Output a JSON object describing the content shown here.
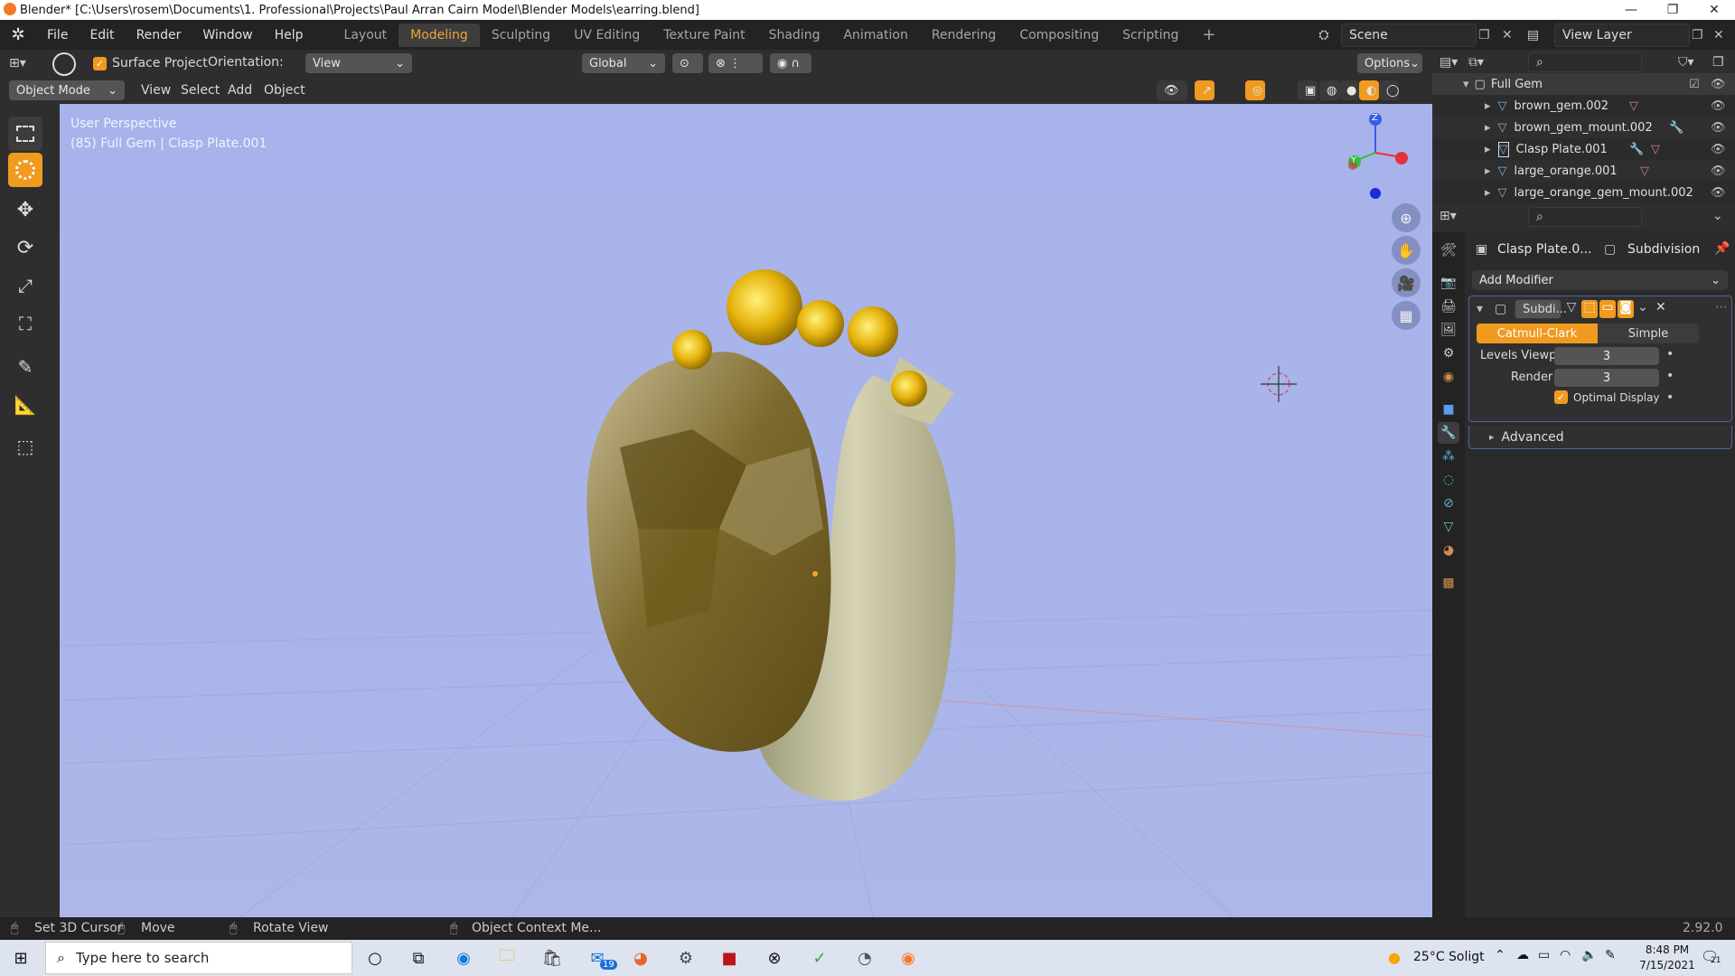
{
  "window": {
    "title": "Blender* [C:\\Users\\rosem\\Documents\\1. Professional\\Projects\\Paul Arran Cairn Model\\Blender Models\\earring.blend]",
    "minimize": "—",
    "maximize": "❐",
    "close": "✕"
  },
  "menus": [
    "File",
    "Edit",
    "Render",
    "Window",
    "Help"
  ],
  "workspaces": [
    "Layout",
    "Modeling",
    "Sculpting",
    "UV Editing",
    "Texture Paint",
    "Shading",
    "Animation",
    "Rendering",
    "Compositing",
    "Scripting"
  ],
  "active_workspace": "Modeling",
  "add_workspace": "+",
  "scene": {
    "label": "Scene"
  },
  "view_layer": {
    "label": "View Layer"
  },
  "tool_header": {
    "surface_project": "Surface Project",
    "orientation_label": "Orientation:",
    "orientation_value": "View",
    "transform_orientation": "Global",
    "options": "Options"
  },
  "view_header": {
    "mode": "Object Mode",
    "menus": [
      "View",
      "Select",
      "Add",
      "Object"
    ]
  },
  "viewport": {
    "perspective": "User Perspective",
    "object_info": "(85) Full Gem | Clasp Plate.001",
    "gizmo_z": "Z",
    "gizmo_y": "Y",
    "colors": {
      "background": "#a9b4ea",
      "x_axis": "#e8303a",
      "y_axis": "#2ec23a",
      "z_axis": "#3a5de8",
      "gold": "#e6b30c",
      "bronze": "#9c8444"
    }
  },
  "outliner": {
    "collection": "Full Gem",
    "items": [
      {
        "name": "brown_gem.002",
        "extra": "mesh-data-icon"
      },
      {
        "name": "brown_gem_mount.002",
        "extra": "modifier-wrench-icon"
      },
      {
        "name": "Clasp Plate.001",
        "extra": "modifier-wrench-icon"
      },
      {
        "name": "large_orange.001",
        "extra": "mesh-data-icon"
      },
      {
        "name": "large_orange_gem_mount.002",
        "extra": "mesh-data-icon"
      }
    ]
  },
  "properties": {
    "object_name": "Clasp Plate.0...",
    "modifier_type": "Subdivision",
    "add_modifier": "Add Modifier",
    "modifier_name": "Subdi...",
    "catmull": "Catmull-Clark",
    "simple": "Simple",
    "levels_label": "Levels Viewp...",
    "levels_value": "3",
    "render_label": "Render",
    "render_value": "3",
    "optimal_display": "Optimal Display",
    "advanced": "Advanced"
  },
  "statusbar": {
    "set_cursor": "Set 3D Cursor",
    "move": "Move",
    "rotate": "Rotate View",
    "context_menu": "Object Context Me...",
    "version": "2.92.0"
  },
  "taskbar": {
    "search_placeholder": "Type here to search",
    "weather": "25°C  Soligt",
    "time": "8:48 PM",
    "date": "7/15/2021",
    "mail_badge": "19",
    "notif_badge": "21"
  }
}
